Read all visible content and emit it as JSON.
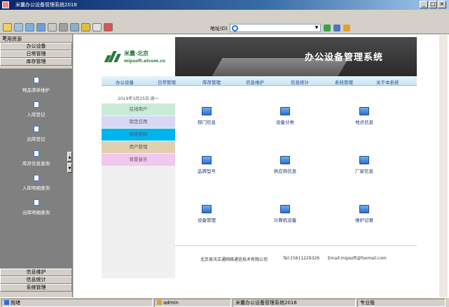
{
  "window": {
    "title": "米囊办公设备管理系统2018",
    "minimize": "_",
    "maximize": "□",
    "close": "×"
  },
  "toolbar": {
    "address_label": "地址(D)",
    "address_value": ""
  },
  "left_panel": {
    "header": "可用资源",
    "close": "×",
    "top_categories": [
      "办公设备",
      "日常管理",
      "库存管理"
    ],
    "items": [
      "物品清单维护",
      "入库登记",
      "出库登记",
      "库存信息查询",
      "入库明细查询",
      "出库明细查询"
    ],
    "bottom_categories": [
      "信息维护",
      "信息统计",
      "系统管理"
    ]
  },
  "site": {
    "logo_cn": "米囊·北京",
    "logo_en": "mipsoft.etcom.cn",
    "system_title": "办公设备管理系统",
    "nav": [
      "办公设备",
      "日常管理",
      "库存管理",
      "信息维护",
      "信息统计",
      "系统管理",
      "关于本系统"
    ],
    "date": "2019年3月25日  周一",
    "side_menu": [
      "在线用户",
      "锁定应用",
      "修改密码",
      "用户管理",
      "背景音乐"
    ],
    "side_colors": [
      "#c8ecd8",
      "#d8d8f4",
      "#00b4f0",
      "#e0d0b0",
      "#f0c8f0"
    ],
    "icons": [
      "部门信息",
      "设备分类",
      "地点信息",
      "品牌型号",
      "供应商信息",
      "厂家信息",
      "设备管理",
      "计算机设备",
      "维护记录"
    ],
    "footer_company": "北京易讯正通网络通信技术有限公司",
    "footer_tel": "Tel:15611229326",
    "footer_email": "Email:mipsoft@foxmail.com"
  },
  "statusbar": {
    "ready": "就绪",
    "user": "admin",
    "app": "米囊办公设备管理系统2018",
    "edition": "专业版"
  },
  "colors": {
    "title_bar": "#0a246a",
    "left_body": "#808080",
    "logo_green": "#2b7a3a",
    "nav_link": "#1a4aa0"
  }
}
